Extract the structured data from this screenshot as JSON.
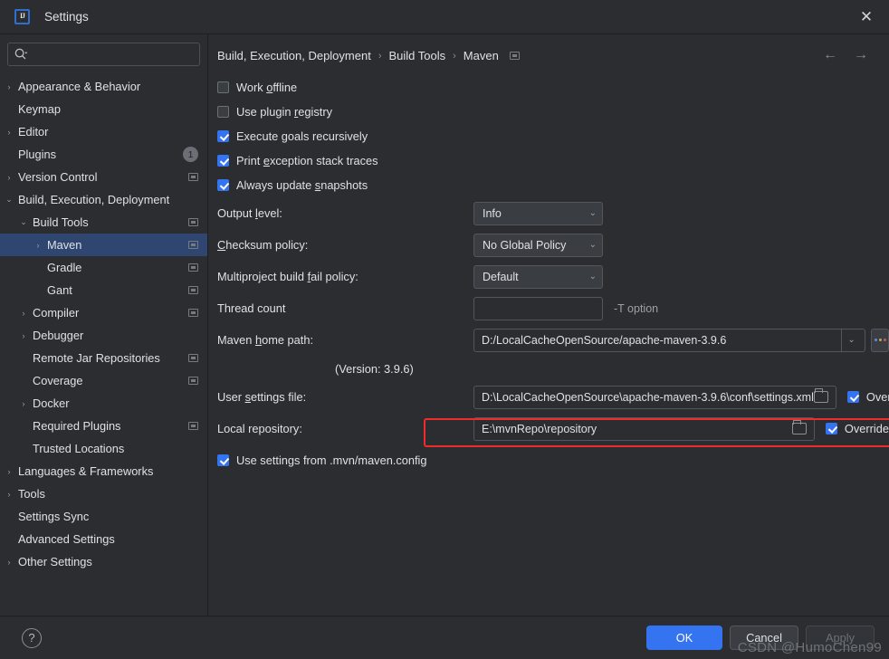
{
  "window": {
    "title": "Settings",
    "logo_text": "IJ",
    "close_icon": "✕"
  },
  "search": {
    "value": "",
    "placeholder": ""
  },
  "sidebar": {
    "items": [
      {
        "label": "Appearance & Behavior",
        "indent": 0,
        "arrow": "›",
        "mark": false,
        "badge": null,
        "selected": false
      },
      {
        "label": "Keymap",
        "indent": 0,
        "arrow": "",
        "mark": false,
        "badge": null,
        "selected": false
      },
      {
        "label": "Editor",
        "indent": 0,
        "arrow": "›",
        "mark": false,
        "badge": null,
        "selected": false
      },
      {
        "label": "Plugins",
        "indent": 0,
        "arrow": "",
        "mark": false,
        "badge": "1",
        "selected": false
      },
      {
        "label": "Version Control",
        "indent": 0,
        "arrow": "›",
        "mark": true,
        "badge": null,
        "selected": false
      },
      {
        "label": "Build, Execution, Deployment",
        "indent": 0,
        "arrow": "⌄",
        "mark": false,
        "badge": null,
        "selected": false
      },
      {
        "label": "Build Tools",
        "indent": 1,
        "arrow": "⌄",
        "mark": true,
        "badge": null,
        "selected": false
      },
      {
        "label": "Maven",
        "indent": 2,
        "arrow": "›",
        "mark": true,
        "badge": null,
        "selected": true
      },
      {
        "label": "Gradle",
        "indent": 2,
        "arrow": "",
        "mark": true,
        "badge": null,
        "selected": false
      },
      {
        "label": "Gant",
        "indent": 2,
        "arrow": "",
        "mark": true,
        "badge": null,
        "selected": false
      },
      {
        "label": "Compiler",
        "indent": 1,
        "arrow": "›",
        "mark": true,
        "badge": null,
        "selected": false
      },
      {
        "label": "Debugger",
        "indent": 1,
        "arrow": "›",
        "mark": false,
        "badge": null,
        "selected": false
      },
      {
        "label": "Remote Jar Repositories",
        "indent": 1,
        "arrow": "",
        "mark": true,
        "badge": null,
        "selected": false
      },
      {
        "label": "Coverage",
        "indent": 1,
        "arrow": "",
        "mark": true,
        "badge": null,
        "selected": false
      },
      {
        "label": "Docker",
        "indent": 1,
        "arrow": "›",
        "mark": false,
        "badge": null,
        "selected": false
      },
      {
        "label": "Required Plugins",
        "indent": 1,
        "arrow": "",
        "mark": true,
        "badge": null,
        "selected": false
      },
      {
        "label": "Trusted Locations",
        "indent": 1,
        "arrow": "",
        "mark": false,
        "badge": null,
        "selected": false
      },
      {
        "label": "Languages & Frameworks",
        "indent": 0,
        "arrow": "›",
        "mark": false,
        "badge": null,
        "selected": false
      },
      {
        "label": "Tools",
        "indent": 0,
        "arrow": "›",
        "mark": false,
        "badge": null,
        "selected": false
      },
      {
        "label": "Settings Sync",
        "indent": 0,
        "arrow": "",
        "mark": false,
        "badge": null,
        "selected": false
      },
      {
        "label": "Advanced Settings",
        "indent": 0,
        "arrow": "",
        "mark": false,
        "badge": null,
        "selected": false
      },
      {
        "label": "Other Settings",
        "indent": 0,
        "arrow": "›",
        "mark": false,
        "badge": null,
        "selected": false
      }
    ]
  },
  "breadcrumb": {
    "parts": [
      "Build, Execution, Deployment",
      "Build Tools",
      "Maven"
    ],
    "separator": "›"
  },
  "nav": {
    "back_icon": "←",
    "forward_icon": "→"
  },
  "main": {
    "checkboxes_top": [
      {
        "label_pre": "Work ",
        "label_key": "o",
        "label_post": "ffline",
        "checked": false
      },
      {
        "label_pre": "Use plugin ",
        "label_key": "r",
        "label_post": "egistry",
        "checked": false
      },
      {
        "label_pre": "Execute ",
        "label_key": "g",
        "label_post": "oals recursively",
        "checked": true
      },
      {
        "label_pre": "Print ",
        "label_key": "e",
        "label_post": "xception stack traces",
        "checked": true
      },
      {
        "label_pre": "Always update ",
        "label_key": "s",
        "label_post": "napshots",
        "checked": true
      }
    ],
    "output_level": {
      "label_pre": "Output ",
      "label_key": "l",
      "label_post": "evel:",
      "value": "Info"
    },
    "checksum_policy": {
      "label_pre": "",
      "label_key": "C",
      "label_post": "hecksum policy:",
      "value": "No Global Policy"
    },
    "multiproject_fail_policy": {
      "label_pre": "Multiproject build ",
      "label_key": "f",
      "label_post": "ail policy:",
      "value": "Default"
    },
    "thread_count": {
      "label": "Thread count",
      "value": "",
      "hint": "-T option"
    },
    "maven_home": {
      "label_pre": "Maven ",
      "label_key": "h",
      "label_post": "ome path:",
      "value": "D:/LocalCacheOpenSource/apache-maven-3.9.6",
      "browse_label": "..."
    },
    "version_note": "(Version: 3.9.6)",
    "user_settings_file": {
      "label_pre": "User ",
      "label_key": "s",
      "label_post": "ettings file:",
      "value": "D:\\LocalCacheOpenSource\\apache-maven-3.9.6\\conf\\settings.xml",
      "override_label": "Override",
      "override_checked": true,
      "highlighted": true
    },
    "local_repository": {
      "label": "Local repository:",
      "value": "E:\\mvnRepo\\repository",
      "override_label": "Override",
      "override_checked": true
    },
    "use_mvn_config": {
      "label": "Use settings from .mvn/maven.config",
      "checked": true
    },
    "chevron_icon": "⌄"
  },
  "footer": {
    "help_icon": "?",
    "ok_label": "OK",
    "cancel_label": "Cancel",
    "apply_label": "Apply"
  },
  "watermark": {
    "text": "CSDN @HumoChen99"
  },
  "colors": {
    "accent_blue": "#3574f0",
    "selection_blue": "#2f4670",
    "annotation_red": "#f02b2b",
    "panel_bg": "#2b2d30",
    "text": "#dfe1e5"
  }
}
